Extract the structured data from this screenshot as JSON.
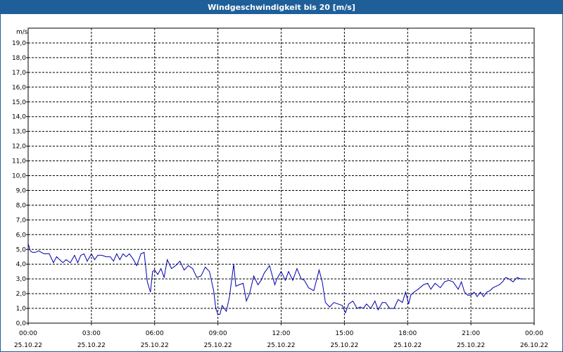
{
  "chart_data": {
    "type": "line",
    "title": "Windgeschwindigkeit bis 20 [m/s]",
    "ylabel": "m/s",
    "xlabel": "",
    "ylim": [
      0,
      20
    ],
    "y_ticks": [
      "0,0",
      "1,0",
      "2,0",
      "3,0",
      "4,0",
      "5,0",
      "6,0",
      "7,0",
      "8,0",
      "9,0",
      "10,0",
      "11,0",
      "12,0",
      "13,0",
      "14,0",
      "15,0",
      "16,0",
      "17,0",
      "18,0",
      "19,0"
    ],
    "x_ticks": [
      {
        "time": "00:00",
        "date": "25.10.22"
      },
      {
        "time": "03:00",
        "date": "25.10.22"
      },
      {
        "time": "06:00",
        "date": "25.10.22"
      },
      {
        "time": "09:00",
        "date": "25.10.22"
      },
      {
        "time": "12:00",
        "date": "25.10.22"
      },
      {
        "time": "15:00",
        "date": "25.10.22"
      },
      {
        "time": "18:00",
        "date": "25.10.22"
      },
      {
        "time": "21:00",
        "date": "25.10.22"
      },
      {
        "time": "00:00",
        "date": "26.10.22"
      }
    ],
    "grid": true,
    "line_color": "#0000aa",
    "series": [
      {
        "x_hours": [
          0,
          0.1,
          0.2,
          0.35,
          0.5,
          0.75,
          1,
          1.2,
          1.35,
          1.5,
          1.65,
          1.8,
          2,
          2.2,
          2.35,
          2.5,
          2.65,
          2.8,
          3,
          3.15,
          3.3,
          3.5,
          3.7,
          3.9,
          4.05,
          4.2,
          4.35,
          4.5,
          4.65,
          4.8,
          5,
          5.15,
          5.35,
          5.5,
          5.65,
          5.8,
          5.9,
          6,
          6.15,
          6.3,
          6.45,
          6.6,
          6.8,
          7,
          7.2,
          7.4,
          7.6,
          7.8,
          8,
          8.2,
          8.4,
          8.6,
          8.8,
          8.9,
          9,
          9.1,
          9.2,
          9.4,
          9.55,
          9.75,
          9.85,
          10,
          10.2,
          10.35,
          10.5,
          10.7,
          10.9,
          11.05,
          11.2,
          11.45,
          11.7,
          11.8,
          12,
          12.2,
          12.35,
          12.55,
          12.75,
          12.95,
          13.1,
          13.3,
          13.55,
          13.8,
          13.95,
          14.1,
          14.3,
          14.5,
          14.7,
          14.9,
          15.05,
          15.2,
          15.4,
          15.6,
          15.75,
          15.9,
          16.05,
          16.25,
          16.45,
          16.6,
          16.8,
          16.95,
          17.15,
          17.35,
          17.55,
          17.75,
          17.9,
          18.05,
          18.15,
          18.3,
          18.5,
          18.75,
          18.95,
          19.1,
          19.3,
          19.55,
          19.75,
          19.95,
          20.15,
          20.4,
          20.55,
          20.7,
          20.85,
          21,
          21.15,
          21.3,
          21.45,
          21.6,
          21.75,
          21.9,
          22.05,
          22.2,
          22.35,
          22.5,
          22.65,
          22.8,
          23,
          23.2,
          23.35,
          23.55,
          23.75,
          23.95
        ],
        "values": [
          5.4,
          4.9,
          4.8,
          4.8,
          4.9,
          4.7,
          4.7,
          4.1,
          4.5,
          4.3,
          4.1,
          4.3,
          4.1,
          4.6,
          4.1,
          4.6,
          4.7,
          4.2,
          4.7,
          4.3,
          4.6,
          4.6,
          4.5,
          4.5,
          4.2,
          4.7,
          4.3,
          4.7,
          4.5,
          4.7,
          4.3,
          3.9,
          4.7,
          4.8,
          2.8,
          2.1,
          3.5,
          3.6,
          3.3,
          3.7,
          3.1,
          4.3,
          3.7,
          3.9,
          4.2,
          3.6,
          3.9,
          3.7,
          3.1,
          3.2,
          3.8,
          3.5,
          2.2,
          1.0,
          0.6,
          0.6,
          1.2,
          0.8,
          1.8,
          4.0,
          2.5,
          2.6,
          2.7,
          1.5,
          2.0,
          3.2,
          2.6,
          2.9,
          3.4,
          3.9,
          2.6,
          3.0,
          3.5,
          2.9,
          3.5,
          2.9,
          3.7,
          3.0,
          2.9,
          2.4,
          2.2,
          3.6,
          2.8,
          1.4,
          1.1,
          1.4,
          1.3,
          1.2,
          0.7,
          1.3,
          1.5,
          1.0,
          1.1,
          1.0,
          1.3,
          1.0,
          1.5,
          0.9,
          1.4,
          1.4,
          1.0,
          1.0,
          1.6,
          1.4,
          2.1,
          1.3,
          1.9,
          2.1,
          2.3,
          2.6,
          2.7,
          2.3,
          2.7,
          2.4,
          2.8,
          2.9,
          2.8,
          2.3,
          2.8,
          2.1,
          1.9,
          1.9,
          2.1,
          1.8,
          2.1,
          1.8,
          2.1,
          2.2,
          2.4,
          2.5,
          2.6,
          2.8,
          3.1,
          3.0,
          2.8,
          3.1,
          3.0,
          3.0
        ]
      }
    ]
  }
}
